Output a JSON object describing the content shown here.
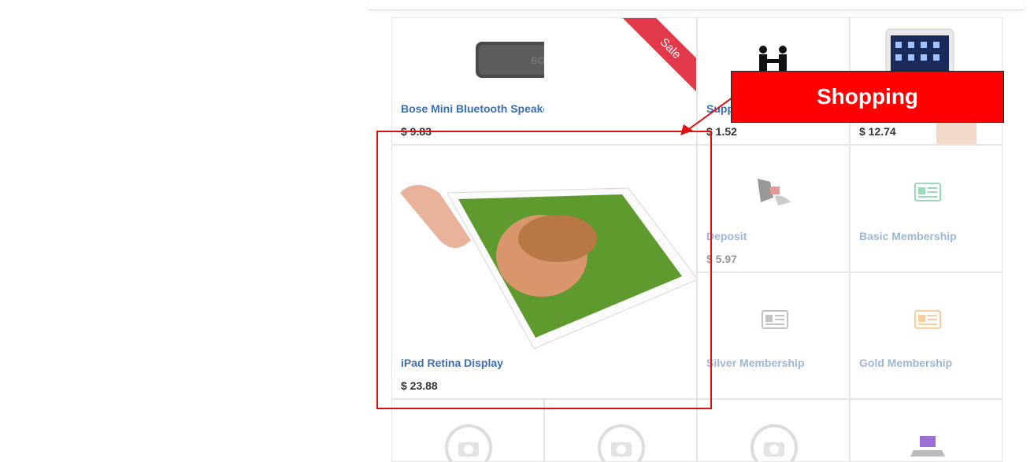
{
  "products": [
    {
      "name": "Bose Mini Bluetooth Speaker",
      "price": "$ 9.83",
      "badge": "Sale",
      "image": "bose-speaker"
    },
    {
      "name": "Supp",
      "price": "$ 1.52",
      "image": "handshake"
    },
    {
      "name": "",
      "price": "$ 12.74",
      "image": "ipad-mini"
    },
    {
      "name": "iPad Retina Display",
      "price": "$ 23.88",
      "image": "ipad-retina"
    },
    {
      "name": "Deposit",
      "price": "$ 5.97",
      "image": "deposit"
    },
    {
      "name": "Basic Membership",
      "image": "membership-card-green"
    },
    {
      "name": "Silver Membership",
      "image": "membership-card-gray"
    },
    {
      "name": "Gold Membership",
      "image": "membership-card-orange"
    },
    {
      "image": "no-photo"
    },
    {
      "image": "no-photo"
    },
    {
      "image": "no-photo"
    },
    {
      "image": "laptop"
    }
  ],
  "annotation": {
    "label": "Shopping",
    "color": "#ff0000"
  }
}
